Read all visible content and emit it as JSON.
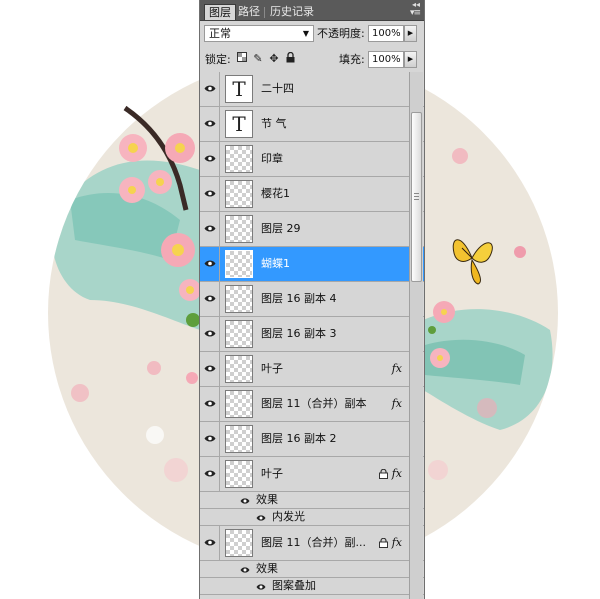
{
  "panel": {
    "tabs": [
      {
        "label": "图层",
        "active": true
      },
      {
        "label": "路径",
        "active": false
      },
      {
        "label": "历史记录",
        "active": false
      }
    ],
    "menu_icon": "panel-menu-icon",
    "blend_mode": "正常",
    "opacity_label": "不透明度:",
    "opacity_value": "100%",
    "lock_label": "锁定:",
    "fill_label": "填充:",
    "fill_value": "100%",
    "lock_icons": [
      "lock-transparency-icon",
      "lock-image-icon",
      "lock-position-icon",
      "lock-all-icon"
    ]
  },
  "layers": [
    {
      "name": "二十四",
      "kind": "text",
      "thumb_glyph": "T",
      "fx": "",
      "selected": false
    },
    {
      "name": "节 气",
      "kind": "text",
      "thumb_glyph": "T",
      "fx": "",
      "selected": false
    },
    {
      "name": "印章",
      "kind": "pixel",
      "fx": "",
      "selected": false
    },
    {
      "name": "樱花1",
      "kind": "pixel",
      "fx": "",
      "selected": false
    },
    {
      "name": "图层 29",
      "kind": "pixel",
      "fx": "",
      "selected": false
    },
    {
      "name": "蝴蝶1",
      "kind": "pixel",
      "fx": "",
      "selected": true
    },
    {
      "name": "图层 16 副本 4",
      "kind": "pixel",
      "fx": "",
      "selected": false
    },
    {
      "name": "图层 16 副本 3",
      "kind": "pixel",
      "fx": "",
      "selected": false
    },
    {
      "name": "叶子",
      "kind": "pixel",
      "fx": "fx",
      "expanded": false,
      "selected": false
    },
    {
      "name": "图层 11（合并）副本",
      "kind": "pixel",
      "fx": "fx",
      "expanded": false,
      "selected": false
    },
    {
      "name": "图层 16 副本 2",
      "kind": "pixel",
      "fx": "",
      "selected": false
    },
    {
      "name": "叶子",
      "kind": "pixel",
      "fx": "fx",
      "locked": true,
      "expanded": true,
      "selected": false,
      "effects_label": "效果",
      "effects": [
        "内发光"
      ]
    },
    {
      "name": "图层 11（合并）副...",
      "kind": "pixel",
      "fx": "fx",
      "locked": true,
      "expanded": true,
      "selected": false,
      "effects_label": "效果",
      "effects": [
        "图案叠加"
      ]
    }
  ],
  "colors": {
    "selection": "#3399ff",
    "panel_bg": "#d6d6d6",
    "tab_bar": "#5a5a5a",
    "canvas_circle": "#ece6dc"
  }
}
